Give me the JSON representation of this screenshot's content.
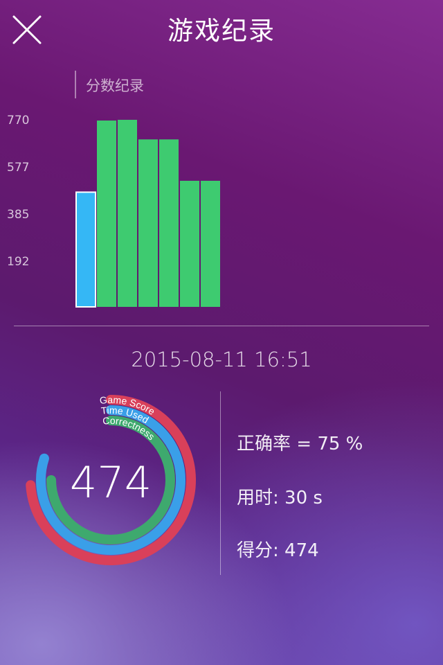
{
  "header": {
    "title": "游戏纪录",
    "close_icon": "close-icon"
  },
  "chart_data": {
    "type": "bar",
    "title": "分数纪录",
    "y_ticks": [
      "770",
      "577",
      "385",
      "192"
    ],
    "values": [
      474,
      770,
      773,
      692,
      692,
      521,
      521
    ],
    "highlight_index": 0,
    "colors": {
      "highlight": "#35b7f5",
      "normal": "#3ecb70"
    }
  },
  "record": {
    "datetime": "2015-08-11   16:51",
    "score": "474",
    "rings": [
      {
        "label": "Game Score",
        "fraction": 0.74,
        "color": "#d9405a"
      },
      {
        "label": "Time Used",
        "fraction": 0.8,
        "color": "#3a9fe8"
      },
      {
        "label": "Correctness",
        "fraction": 0.75,
        "color": "#3ea96e"
      }
    ],
    "stats": {
      "accuracy": "正确率 = 75 %",
      "time": "用时: 30 s",
      "score": "得分: 474"
    }
  }
}
